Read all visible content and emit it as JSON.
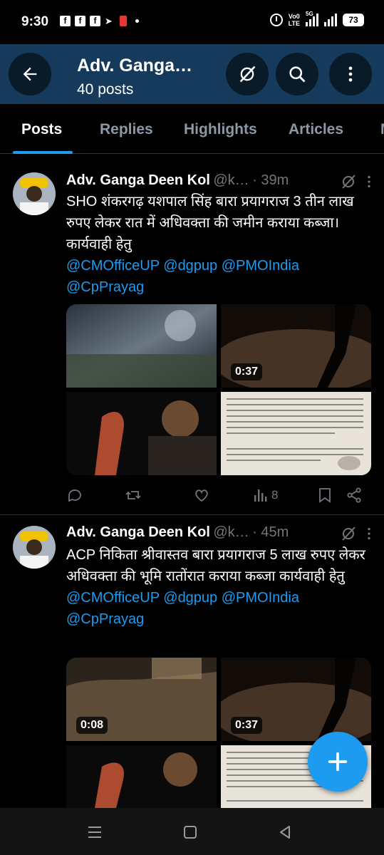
{
  "status_bar": {
    "time": "9:30",
    "network": "Vo0 LTE",
    "network_line1": "Vo0",
    "network_line2": "LTE",
    "gen": "5G",
    "battery": "73"
  },
  "header": {
    "title": "Adv. Ganga…",
    "subtitle": "40 posts"
  },
  "tabs": [
    {
      "label": "Posts",
      "active": true
    },
    {
      "label": "Replies"
    },
    {
      "label": "Highlights"
    },
    {
      "label": "Articles"
    }
  ],
  "posts": [
    {
      "name": "Adv. Ganga Deen Kol",
      "handle": "@k…",
      "time": "39m",
      "text": "SHO शंकरगढ़ यशपाल सिंह बारा प्रयागराज 3 तीन लाख रुपए लेकर रात में अधिवक्ता की जमीन कराया कब्जा। कार्यवाही हेतु",
      "mentions_line1": "@CMOfficeUP @dgpup @PMOIndia",
      "mentions_line2": "@CpPrayag",
      "media": [
        {
          "type": "video"
        },
        {
          "type": "video",
          "duration": "0:37"
        },
        {
          "type": "video"
        },
        {
          "type": "image",
          "kind": "document"
        }
      ],
      "views": "8"
    },
    {
      "name": "Adv. Ganga Deen Kol",
      "handle": "@k…",
      "time": "45m",
      "text": "ACP निकिता श्रीवास्तव बारा प्रयागराज 5 लाख रुपए लेकर अधिवक्ता की भूमि रातोंरात कराया कब्जा कार्यवाही हेतु",
      "mentions_line1": "@CMOfficeUP @dgpup @PMOIndia",
      "mentions_line2": "@CpPrayag",
      "media": [
        {
          "type": "video",
          "duration": "0:08"
        },
        {
          "type": "video",
          "duration": "0:37"
        },
        {
          "type": "video"
        },
        {
          "type": "image",
          "kind": "document"
        }
      ]
    }
  ],
  "icons": {
    "back": "back-arrow-icon",
    "grok": "grok-icon",
    "search": "search-icon",
    "more": "more-vertical-icon",
    "reply": "reply-icon",
    "retweet": "retweet-icon",
    "like": "like-icon",
    "views": "views-icon",
    "bookmark": "bookmark-icon",
    "share": "share-icon",
    "compose": "compose-plus-icon"
  },
  "colors": {
    "accent": "#1d9bf0",
    "header_bg": "#163a5b",
    "background": "#000000",
    "muted": "#71767b"
  }
}
